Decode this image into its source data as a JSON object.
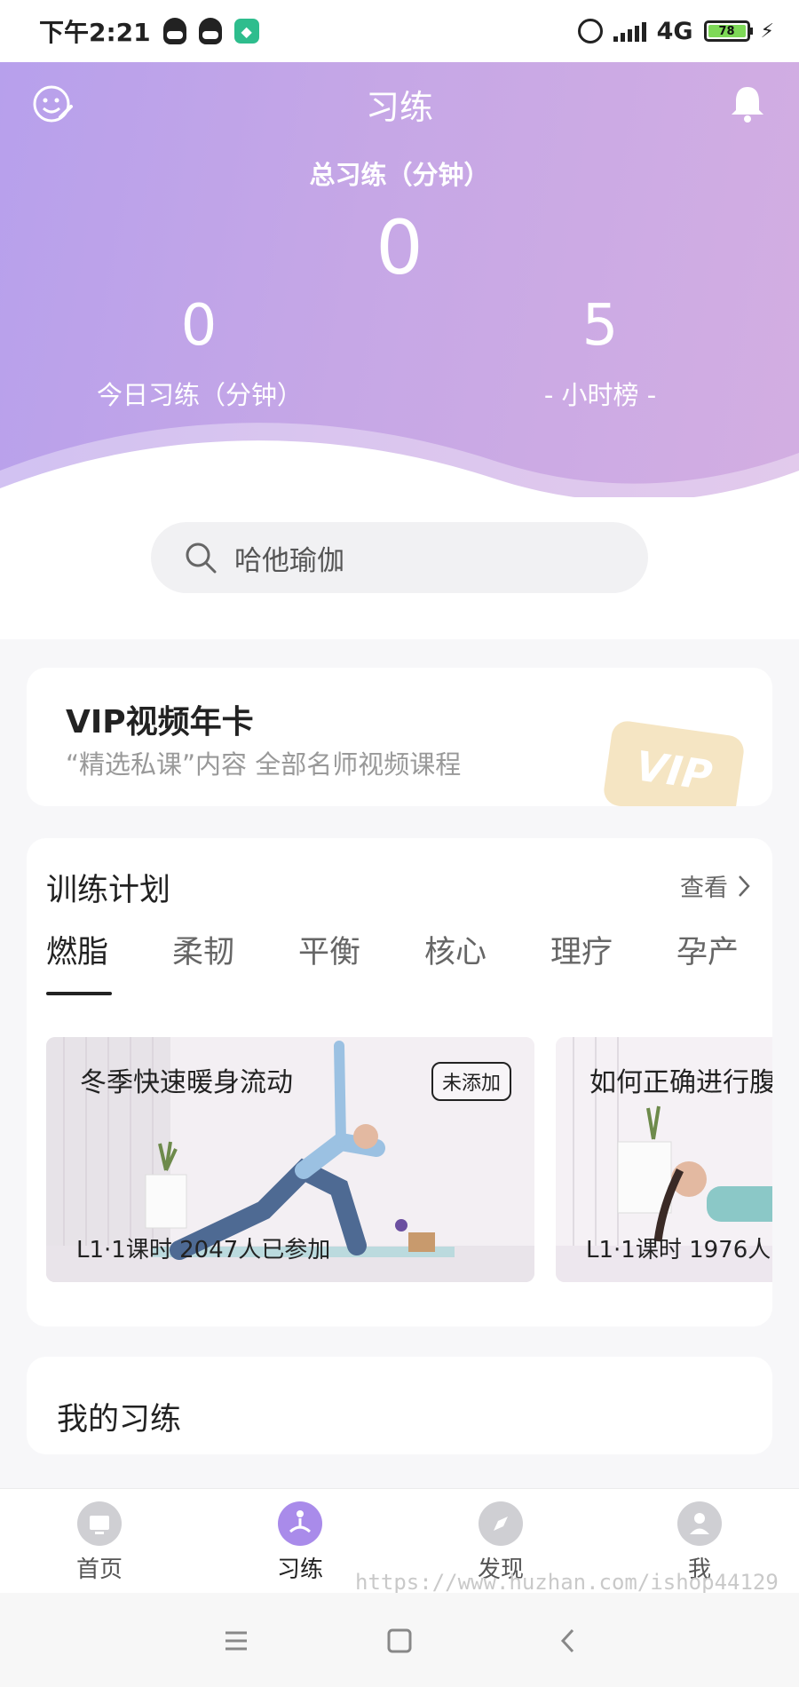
{
  "status_bar": {
    "time": "下午2:21",
    "network": "4G",
    "battery": "78"
  },
  "header": {
    "title": "习练",
    "total_label": "总习练（分钟）",
    "total_value": "0",
    "today_value": "0",
    "today_label": "今日习练（分钟）",
    "rank_value": "5",
    "rank_label": "- 小时榜 -",
    "accent_color": "#b7a0ec"
  },
  "search": {
    "placeholder": "哈他瑜伽"
  },
  "vip": {
    "title": "VIP视频年卡",
    "subtitle": "“精选私课”内容 全部名师视频课程",
    "badge": "VIP"
  },
  "plan": {
    "title": "训练计划",
    "more": "查看",
    "tabs": [
      "燃脂",
      "柔韧",
      "平衡",
      "核心",
      "理疗",
      "孕产"
    ],
    "courses": [
      {
        "title": "冬季快速暖身流动",
        "tag": "未添加",
        "meta": "L1·1课时  2047人已参加"
      },
      {
        "title": "如何正确进行腹",
        "meta": "L1·1课时  1976人"
      }
    ]
  },
  "my_practice": {
    "title": "我的习练"
  },
  "bottom_nav": {
    "items": [
      "首页",
      "习练",
      "发现",
      "我"
    ]
  },
  "watermark": "https://www.huzhan.com/ishop44129"
}
